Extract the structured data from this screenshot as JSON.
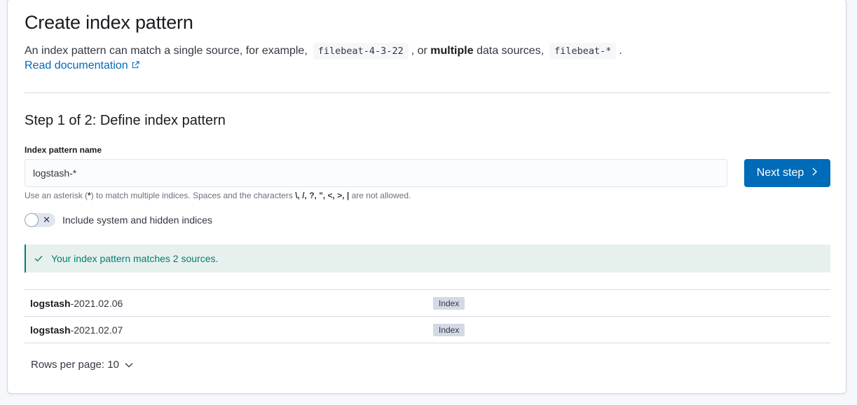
{
  "page": {
    "title": "Create index pattern",
    "description": {
      "part1": "An index pattern can match a single source, for example,",
      "code1": "filebeat-4-3-22",
      "part2": ", or",
      "bold": "multiple",
      "part3": "data sources,",
      "code2": "filebeat-*",
      "part4": "."
    },
    "doc_link": "Read documentation",
    "doc_link_icon": "popout-icon"
  },
  "step": {
    "title": "Step 1 of 2: Define index pattern",
    "field_label": "Index pattern name",
    "input_value": "logstash-*",
    "next_button": "Next step",
    "next_icon": "chevron-right-icon",
    "help": {
      "part1": "Use an asterisk (",
      "asterisk": "*",
      "part2": ") to match multiple indices. Spaces and the characters",
      "chars": "\\, /, ?, \", <, >, |",
      "part3": "are not allowed."
    },
    "toggle_label": "Include system and hidden indices",
    "toggle_on": false
  },
  "callout": {
    "text": "Your index pattern matches 2 sources.",
    "icon": "check-icon"
  },
  "table": {
    "rows": [
      {
        "name_bold": "logstash",
        "name_rest": "-2021.02.06",
        "badge": "Index"
      },
      {
        "name_bold": "logstash",
        "name_rest": "-2021.02.07",
        "badge": "Index"
      }
    ]
  },
  "pagination": {
    "rows_per_page": "Rows per page: 10"
  },
  "colors": {
    "primary": "#006bb8",
    "success": "#017d73",
    "success_bg": "#e6f1ee"
  }
}
